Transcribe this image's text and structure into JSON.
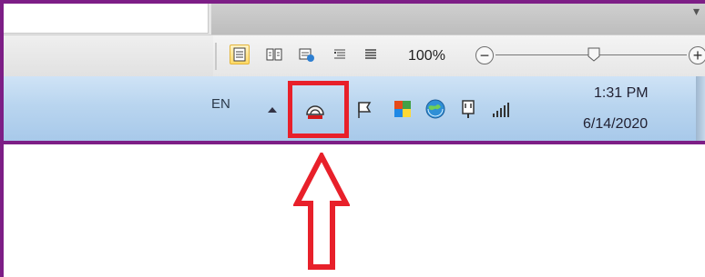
{
  "status_bar": {
    "zoom_level": "100%",
    "zoom_minus": "−",
    "zoom_plus": "+",
    "zoom_fraction": 0.48
  },
  "taskbar": {
    "language": "EN",
    "clock": {
      "time": "1:31 PM",
      "date": "6/14/2020"
    }
  },
  "colors": {
    "frame": "#7d1e86",
    "highlight": "#e8202a",
    "taskbar": "#b9d5ef"
  },
  "icons": {
    "tray": [
      "show-hidden-icons",
      "hotspot-router-icon",
      "flag-icon",
      "colorful-app-icon",
      "network-globe-icon",
      "power-plug-icon",
      "signal-bars-icon"
    ],
    "views": [
      "print-layout-icon",
      "full-screen-reading-icon",
      "web-layout-icon",
      "outline-icon",
      "draft-icon"
    ]
  }
}
